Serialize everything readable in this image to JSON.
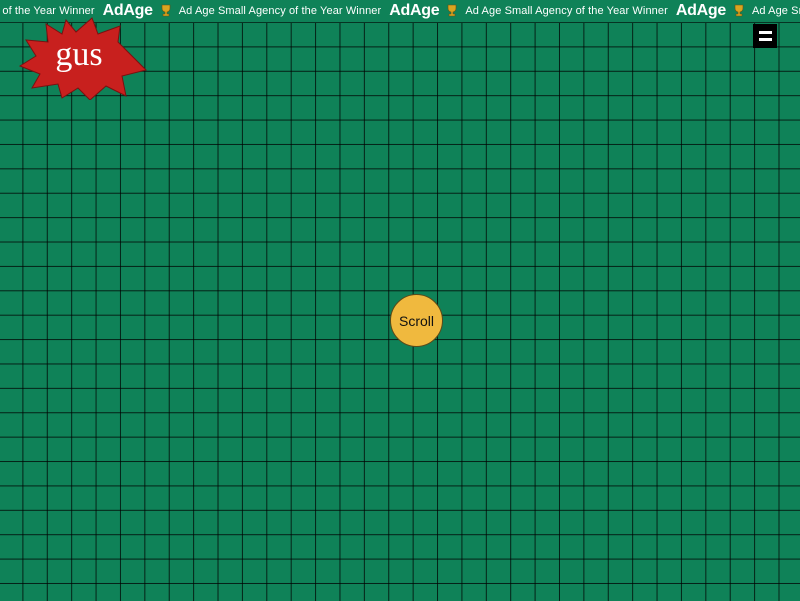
{
  "ticker": {
    "items": [
      {
        "brand": "",
        "award": "cy of the Year Winner"
      },
      {
        "brand": "AdAge",
        "award": "Ad Age Small Agency of the Year Winner"
      },
      {
        "brand": "AdAge",
        "award": "Ad Age Small Agency of the Year Winner"
      },
      {
        "brand": "AdAge",
        "award": "Ad Age Small Agency of the Year Winner"
      }
    ]
  },
  "logo": {
    "text": "gus"
  },
  "main": {
    "scroll_label": "Scroll"
  },
  "colors": {
    "background": "#0f8258",
    "grid_lines": "#000000",
    "logo_starburst": "#c8201e",
    "scroll_button": "#f0b93e",
    "menu_button": "#000000"
  },
  "icons": {
    "menu": "hamburger-icon",
    "trophy": "trophy-icon"
  }
}
